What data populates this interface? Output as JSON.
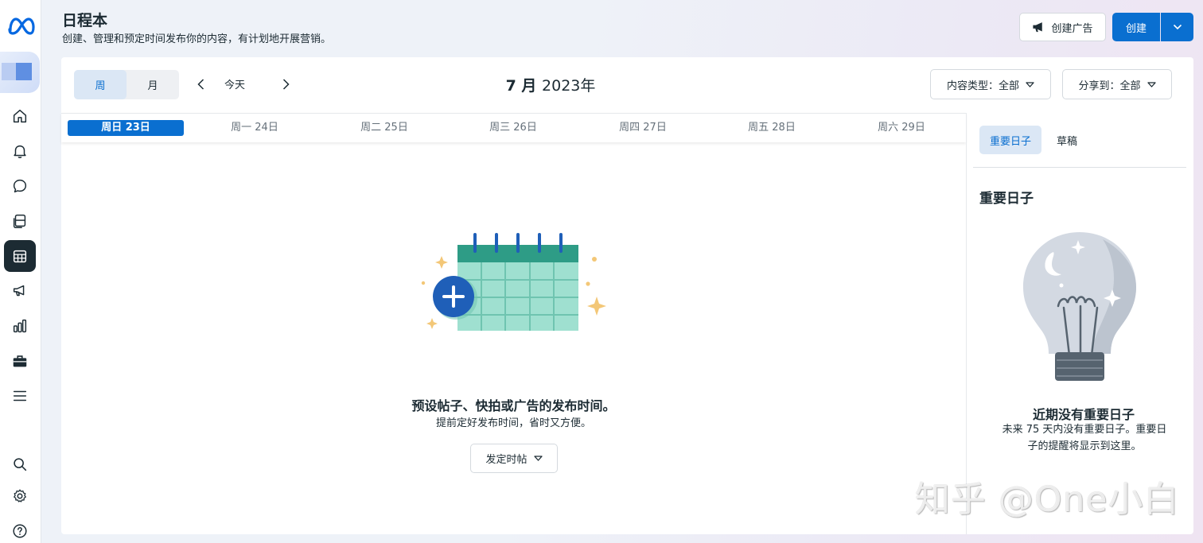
{
  "header": {
    "title": "日程本",
    "subtitle": "创建、管理和预定时间发布你的内容，有计划地开展营销。",
    "create_ad_label": "创建广告",
    "create_label": "创建"
  },
  "toolbar": {
    "view_week": "周",
    "view_month": "月",
    "today": "今天",
    "month_num": "7 月",
    "year": "2023年",
    "content_type_filter": "内容类型：全部",
    "share_to_filter": "分享到：全部"
  },
  "days": [
    "周日 23日",
    "周一 24日",
    "周二 25日",
    "周三 26日",
    "周四 27日",
    "周五 28日",
    "周六 29日"
  ],
  "empty_state": {
    "title": "预设帖子、快拍或广告的发布时间。",
    "subtitle": "提前定好发布时间，省时又方便。",
    "schedule_button": "发定时帖"
  },
  "right_panel": {
    "tab_important": "重要日子",
    "tab_drafts": "草稿",
    "heading": "重要日子",
    "empty_title": "近期没有重要日子",
    "empty_sub": "未来 75 天内没有重要日子。重要日子的提醒将显示到这里。"
  },
  "watermark": "知乎 @One小白",
  "colors": {
    "accent": "#0a6fd0",
    "nav_active": "#1c2b33",
    "calendar_green": "#9fe0d0"
  },
  "rail_icons": [
    "meta-logo",
    "avatar",
    "home-icon",
    "bell-icon",
    "chat-icon",
    "pages-icon",
    "calendar-icon",
    "megaphone-icon",
    "chart-icon",
    "briefcase-icon",
    "menu-icon",
    "search-icon",
    "settings-icon",
    "help-icon"
  ]
}
